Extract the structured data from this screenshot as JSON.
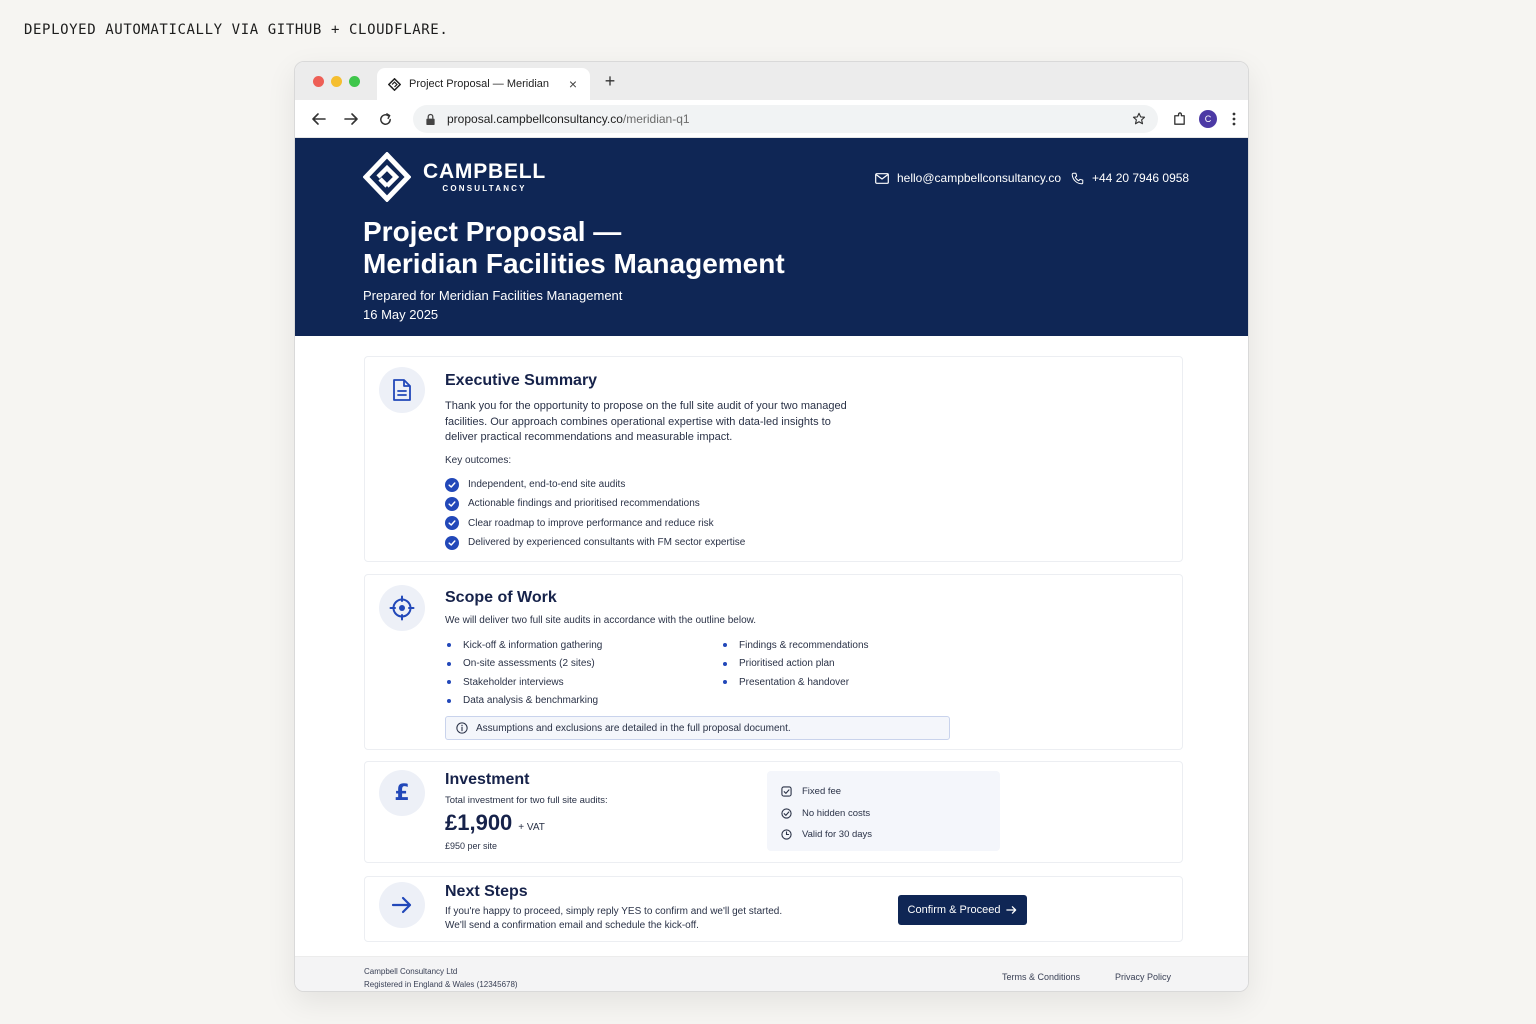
{
  "caption": "DEPLOYED AUTOMATICALLY VIA GITHUB + CLOUDFLARE.",
  "browser": {
    "tab_title": "Project Proposal — Meridian",
    "url_host": "proposal.campbellconsultancy.co",
    "url_path": "/meridian-q1",
    "profile_initial": "C",
    "icons": [
      "back-icon",
      "forward-icon",
      "reload-icon",
      "lock-icon",
      "star-icon",
      "extension-icon",
      "more-icon"
    ]
  },
  "header": {
    "brand_name": "CAMPBELL",
    "brand_sub": "CONSULTANCY",
    "email": "hello@campbellconsultancy.co",
    "phone": "+44 20 7946 0958",
    "title_line1": "Project Proposal —",
    "title_line2": "Meridian Facilities Management",
    "prepared_for": "Prepared for Meridian Facilities Management",
    "date": "16 May 2025"
  },
  "executive_summary": {
    "title": "Executive Summary",
    "body_lines": [
      "Thank you for the opportunity to propose on the full site audit of your two managed",
      "facilities. Our approach combines operational expertise with data-led insights to",
      "deliver practical recommendations and measurable impact."
    ],
    "outcomes_label": "Key outcomes:",
    "outcomes": [
      "Independent, end-to-end site audits",
      "Actionable findings and prioritised recommendations",
      "Clear roadmap to improve performance and reduce risk",
      "Delivered by experienced consultants with FM sector expertise"
    ]
  },
  "scope": {
    "title": "Scope of Work",
    "intro": "We will deliver two full site audits in accordance with the outline below.",
    "left_items": [
      "Kick-off & information gathering",
      "On-site assessments (2 sites)",
      "Stakeholder interviews",
      "Data analysis & benchmarking"
    ],
    "right_items": [
      "Findings & recommendations",
      "Prioritised action plan",
      "Presentation & handover"
    ],
    "note": "Assumptions and exclusions are detailed in the full proposal document."
  },
  "investment": {
    "title": "Investment",
    "subtitle": "Total investment for two full site audits:",
    "amount": "£1,900",
    "vat": "+ VAT",
    "per_site": "£950 per site",
    "features": [
      "Fixed fee",
      "No hidden costs",
      "Valid for 30 days"
    ]
  },
  "next_steps": {
    "title": "Next Steps",
    "line1": "If you're happy to proceed, simply reply YES to confirm and we'll get started.",
    "line2": "We'll send a confirmation email and schedule the kick-off.",
    "cta_label": "Confirm & Proceed"
  },
  "footer": {
    "company": "Campbell Consultancy Ltd",
    "registration": "Registered in England & Wales (12345678)",
    "terms": "Terms & Conditions",
    "privacy": "Privacy Policy"
  },
  "colors": {
    "navy": "#0f2655",
    "accent_blue": "#2248b9",
    "icon_bg": "#edf0f7",
    "page_bg": "#f6f5f2"
  }
}
